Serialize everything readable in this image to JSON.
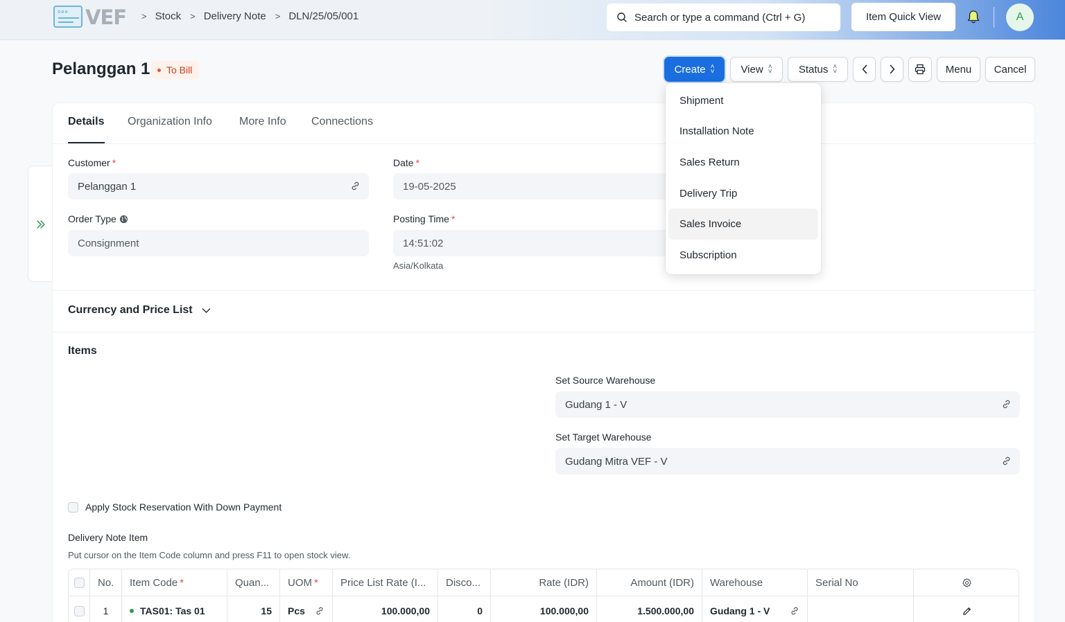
{
  "app": {
    "logo_text": "VEF"
  },
  "breadcrumb": [
    "Stock",
    "Delivery Note",
    "DLN/25/05/001"
  ],
  "search": {
    "placeholder": "Search or type a command (Ctrl + G)"
  },
  "header": {
    "quick_view": "Item Quick View",
    "avatar_initial": "A"
  },
  "page": {
    "title": "Pelanggan 1",
    "status": "To Bill",
    "buttons": {
      "create": "Create",
      "view": "View",
      "status": "Status",
      "menu": "Menu",
      "cancel": "Cancel"
    }
  },
  "create_menu": {
    "items": [
      "Shipment",
      "Installation Note",
      "Sales Return",
      "Delivery Trip",
      "Sales Invoice",
      "Subscription"
    ],
    "hovered": "Sales Invoice"
  },
  "tabs": [
    "Details",
    "Organization Info",
    "More Info",
    "Connections"
  ],
  "form": {
    "customer": {
      "label": "Customer",
      "value": "Pelanggan 1"
    },
    "date": {
      "label": "Date",
      "value": "19-05-2025"
    },
    "order_type": {
      "label": "Order Type",
      "value": "Consignment"
    },
    "posting_time": {
      "label": "Posting Time",
      "value": "14:51:02",
      "timezone": "Asia/Kolkata"
    }
  },
  "sections": {
    "currency": "Currency and Price List",
    "items": "Items"
  },
  "warehouses": {
    "source": {
      "label": "Set Source Warehouse",
      "value": "Gudang 1 - V"
    },
    "target": {
      "label": "Set Target Warehouse",
      "value": "Gudang Mitra VEF - V"
    }
  },
  "apply_reservation": {
    "label": "Apply Stock Reservation With Down Payment",
    "checked": false
  },
  "delivery_items": {
    "label": "Delivery Note Item",
    "hint": "Put cursor on the Item Code column and press F11 to open stock view.",
    "columns": {
      "no": "No.",
      "item_code": "Item Code",
      "quantity": "Quan...",
      "uom": "UOM",
      "price_list_rate": "Price List Rate (I...",
      "discount": "Disco...",
      "rate": "Rate (IDR)",
      "amount": "Amount (IDR)",
      "warehouse": "Warehouse",
      "serial_no": "Serial No"
    },
    "rows": [
      {
        "no": "1",
        "item_code": "TAS01: Tas 01",
        "quantity": "15",
        "uom": "Pcs",
        "price_list_rate": "100.000,00",
        "discount": "0",
        "rate": "100.000,00",
        "amount": "1.500.000,00",
        "warehouse": "Gudang 1 - V",
        "serial_no": ""
      }
    ]
  },
  "colors": {
    "primary": "#1a6ee0",
    "status_to_bill": "#c4431f",
    "active_green": "#2e9a4f"
  }
}
